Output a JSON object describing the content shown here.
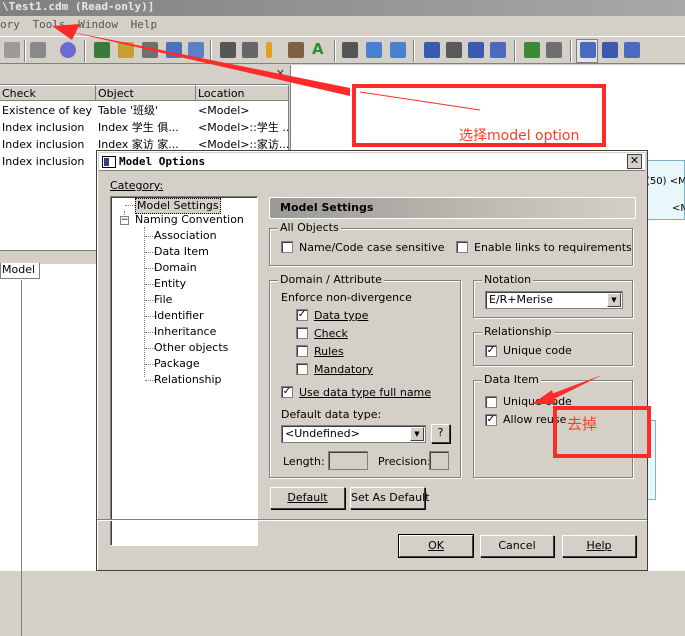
{
  "app": {
    "title": "\\Test1.cdm (Read-only)]",
    "menu": [
      "ory",
      "Tools",
      "Window",
      "Help"
    ]
  },
  "check_panel": {
    "columns": [
      "Check",
      "Object",
      "Location"
    ],
    "rows": [
      [
        "Existence of key",
        "Table '班级'",
        "<Model>"
      ],
      [
        "Index inclusion",
        "Index 学生 俱...",
        "<Model>::学生 ..."
      ],
      [
        "Index inclusion",
        "Index 家访 家...",
        "<Model>::家访..."
      ],
      [
        "Index inclusion",
        "",
        ""
      ]
    ],
    "tab": "Model"
  },
  "canvas": {
    "text1": "(50) <M",
    "text2": "<M"
  },
  "annotations": {
    "note1": "选择model option",
    "note2": "去掉",
    "color": "#ff2a2a"
  },
  "dialog": {
    "title": "Model Options",
    "category_label": "Category:",
    "tree": {
      "root": "Model Settings",
      "naming": "Naming Convention",
      "children": [
        "Association",
        "Data Item",
        "Domain",
        "Entity",
        "File",
        "Identifier",
        "Inheritance",
        "Other objects",
        "Package",
        "Relationship"
      ]
    },
    "section_title": "Model Settings",
    "all_objects": {
      "label": "All Objects",
      "name_code_case": {
        "label": "Name/Code case sensitive",
        "checked": false
      },
      "enable_links": {
        "label": "Enable links to requirements",
        "checked": false
      }
    },
    "domain_attr": {
      "label": "Domain / Attribute",
      "enforce": "Enforce non-divergence",
      "data_type": {
        "label": "Data type",
        "checked": true
      },
      "check": {
        "label": "Check",
        "checked": false
      },
      "rules": {
        "label": "Rules",
        "checked": false
      },
      "mandatory": {
        "label": "Mandatory",
        "checked": false
      },
      "full_name": {
        "label": "Use data type full name",
        "checked": true
      },
      "default_type_label": "Default data type:",
      "default_type_value": "<Undefined>",
      "help_btn": "?",
      "length_label": "Length:",
      "precision_label": "Precision:"
    },
    "notation": {
      "label": "Notation",
      "value": "E/R+Merise"
    },
    "relationship": {
      "label": "Relationship",
      "unique_code": {
        "label": "Unique code",
        "checked": true
      }
    },
    "data_item": {
      "label": "Data Item",
      "unique_code": {
        "label": "Unique code",
        "checked": false
      },
      "allow_reuse": {
        "label": "Allow reuse",
        "checked": true
      }
    },
    "buttons": {
      "default": "Default",
      "set_default": "Set As Default",
      "ok": "OK",
      "cancel": "Cancel",
      "help": "Help"
    }
  }
}
